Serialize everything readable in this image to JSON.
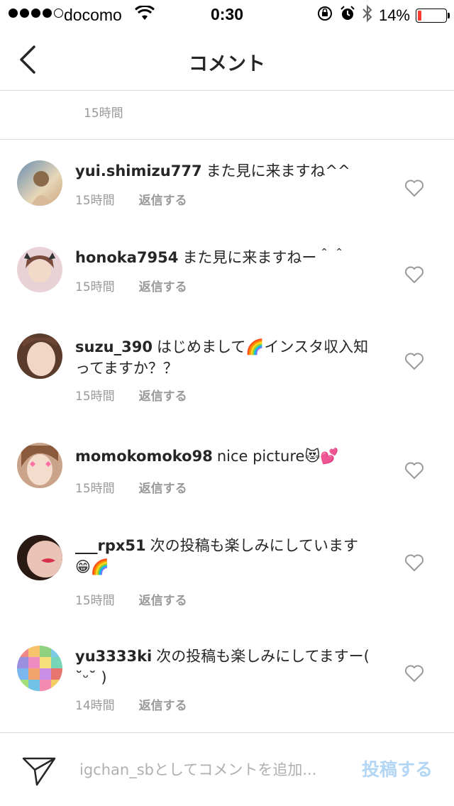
{
  "status_bar": {
    "carrier": "docomo",
    "time": "0:30",
    "battery_percent": "14%",
    "battery_level": 0.14,
    "signal_bars_filled": 4,
    "signal_bars_total": 5
  },
  "nav": {
    "title": "コメント"
  },
  "previous_comment": {
    "time": "15時間"
  },
  "reply_label": "返信する",
  "comments": [
    {
      "username": "yui.shimizu777",
      "text": "また見に来ますね^^",
      "time": "15時間",
      "reply": "返信する"
    },
    {
      "username": "honoka7954",
      "text": "また見に来ますねー＾＾",
      "time": "15時間",
      "reply": "返信する"
    },
    {
      "username": "suzu_390",
      "text": "はじめまして🌈インスタ収入知ってますか？？",
      "time": "15時間",
      "reply": "返信する"
    },
    {
      "username": "momokomoko98",
      "text": "nice picture😻💕",
      "time": "15時間",
      "reply": "返信する"
    },
    {
      "username": "___rpx51",
      "text": "次の投稿も楽しみにしています😁🌈",
      "time": "15時間",
      "reply": "返信する"
    },
    {
      "username": "yu3333ki",
      "text": "次の投稿も楽しみにしてますー( ˘ᵕ˘ )",
      "time": "14時間",
      "reply": "返信する"
    }
  ],
  "composer": {
    "placeholder": "igchan_sbとしてコメントを追加...",
    "value": "",
    "post_label": "投稿する"
  },
  "colors": {
    "text": "#262626",
    "secondary": "#999999",
    "divider": "#dbdbdb",
    "post_disabled": "#b3d6f5",
    "battery_low": "#ff3b30"
  }
}
